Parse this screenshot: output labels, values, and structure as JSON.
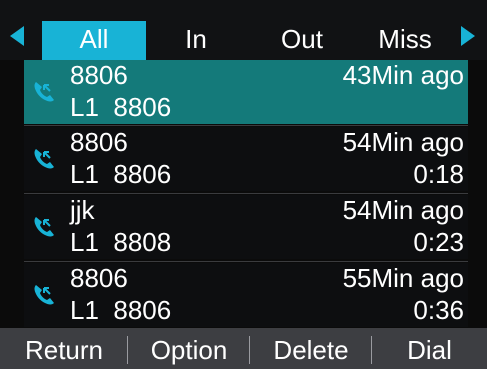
{
  "tabs": [
    {
      "label": "All",
      "active": true
    },
    {
      "label": "In",
      "active": false
    },
    {
      "label": "Out",
      "active": false
    },
    {
      "label": "Miss",
      "active": false
    }
  ],
  "calls": [
    {
      "name": "8806",
      "line": "L1",
      "number": "8806",
      "time": "43Min ago",
      "duration": "",
      "selected": true,
      "icon": "incoming-call-icon"
    },
    {
      "name": "8806",
      "line": "L1",
      "number": "8806",
      "time": "54Min ago",
      "duration": "0:18",
      "selected": false,
      "icon": "incoming-call-icon"
    },
    {
      "name": "jjk",
      "line": "L1",
      "number": "8808",
      "time": "54Min ago",
      "duration": "0:23",
      "selected": false,
      "icon": "incoming-call-icon"
    },
    {
      "name": "8806",
      "line": "L1",
      "number": "8806",
      "time": "55Min ago",
      "duration": "0:36",
      "selected": false,
      "icon": "incoming-call-icon"
    }
  ],
  "softkeys": {
    "return": "Return",
    "option": "Option",
    "delete": "Delete",
    "dial": "Dial"
  },
  "colors": {
    "accent": "#18b3d6",
    "selected_row": "#147a7a",
    "icon": "#18b3d6",
    "softkey_bar": "#3d3e42"
  }
}
